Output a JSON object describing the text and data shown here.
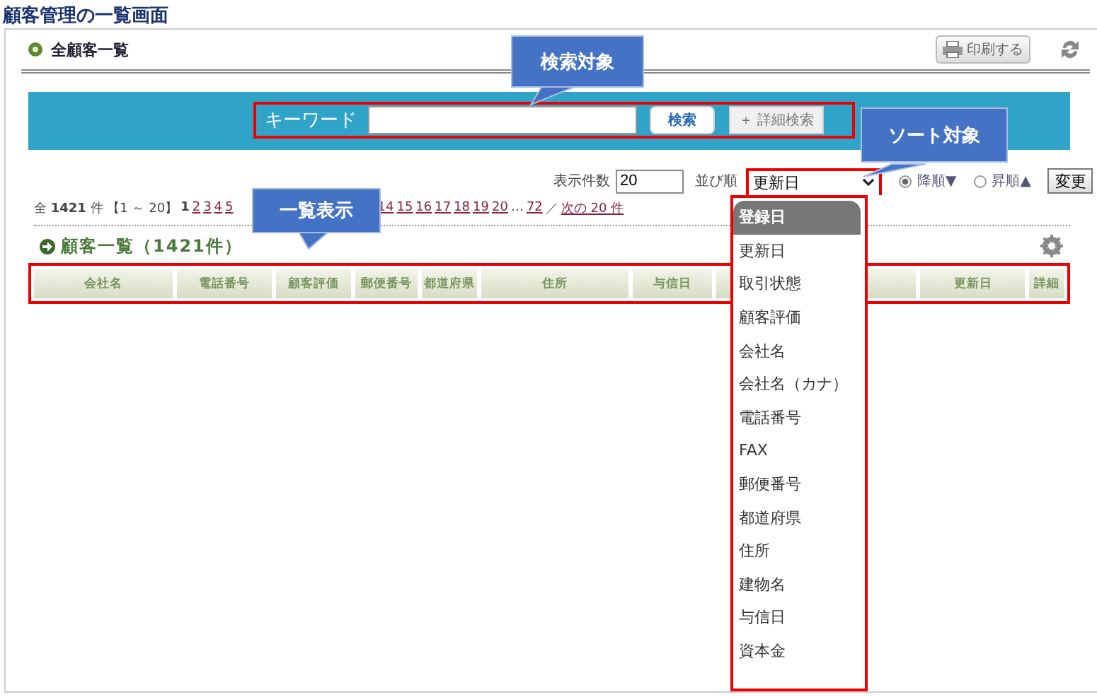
{
  "page_title": "顧客管理の一覧画面",
  "panel": {
    "title": "全顧客一覧",
    "print_button": "印刷する"
  },
  "search": {
    "label": "キーワード",
    "search_button": "検索",
    "advanced_button": "＋ 詳細検索"
  },
  "controls": {
    "per_page_label": "表示件数",
    "per_page_value": "20",
    "sort_label": "並び順",
    "sort_value": "更新日",
    "order_options": [
      {
        "label": "降順▼",
        "selected": true
      },
      {
        "label": "昇順▲",
        "selected": false
      }
    ],
    "apply_button": "変更"
  },
  "pagination": {
    "summary": "全 **1421** 件 【1 ～ 20】",
    "current": "1",
    "pages": [
      "2",
      "3",
      "4",
      "5"
    ],
    "pages_after": [
      "14",
      "15",
      "16",
      "17",
      "18",
      "19",
      "20"
    ],
    "ellipsis": "…",
    "last": "72",
    "separator": "／",
    "next": "次の 20 件"
  },
  "list": {
    "title": "顧客一覧（1421件）",
    "columns": [
      {
        "label": "会社名"
      },
      {
        "label": "電話番号"
      },
      {
        "label": "顧客評価"
      },
      {
        "label": "郵便番号"
      },
      {
        "label": "都道府県"
      },
      {
        "label": "住所"
      },
      {
        "label": "与信日"
      },
      {},
      {},
      {
        "label": "更新日"
      },
      {
        "label": "詳細"
      }
    ]
  },
  "dropdown": {
    "options": [
      {
        "label": "登録日",
        "selected": true
      },
      {
        "label": "更新日",
        "selected": false
      },
      {
        "label": "取引状態",
        "selected": false
      },
      {
        "label": "顧客評価",
        "selected": false
      },
      {
        "label": "会社名",
        "selected": false
      },
      {
        "label": "会社名（カナ）",
        "selected": false
      },
      {
        "label": "電話番号",
        "selected": false
      },
      {
        "label": "FAX",
        "selected": false
      },
      {
        "label": "郵便番号",
        "selected": false
      },
      {
        "label": "都道府県",
        "selected": false
      },
      {
        "label": "住所",
        "selected": false
      },
      {
        "label": "建物名",
        "selected": false
      },
      {
        "label": "与信日",
        "selected": false
      },
      {
        "label": "資本金",
        "selected": false
      }
    ]
  },
  "callouts": [
    {
      "text": "検索対象"
    },
    {
      "text": "ソート対象"
    },
    {
      "text": "一覧表示"
    }
  ]
}
